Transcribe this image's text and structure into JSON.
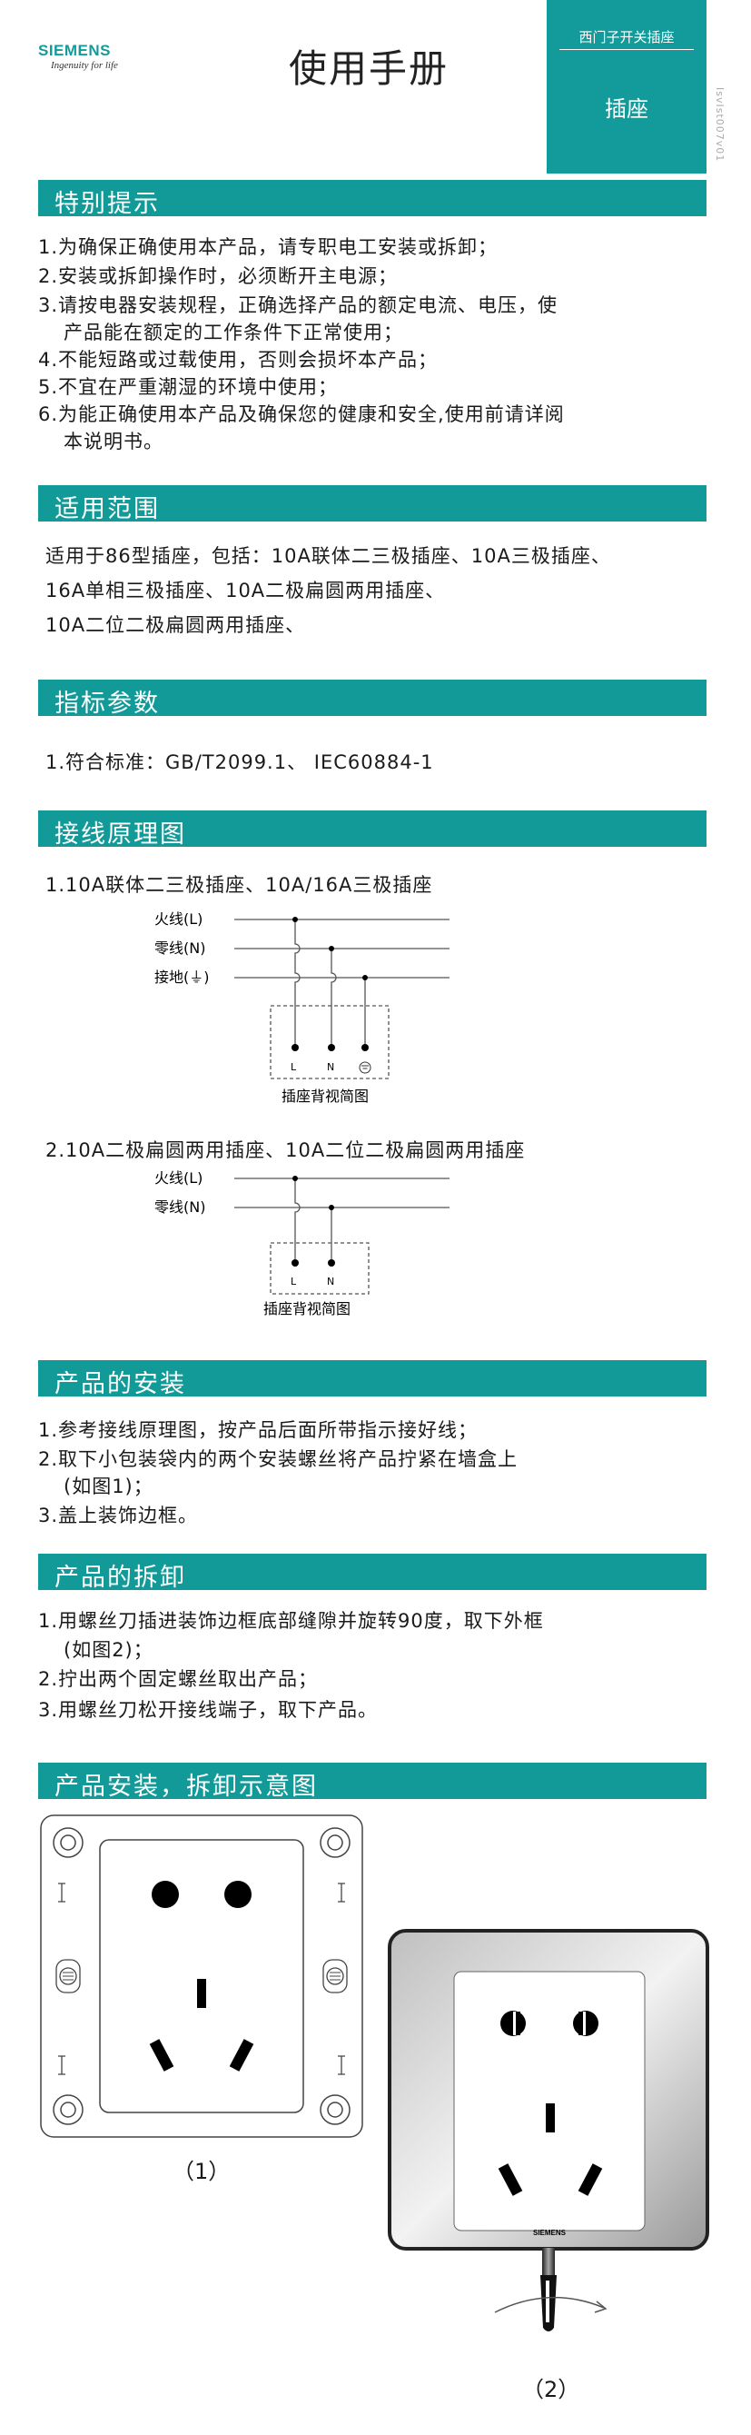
{
  "header": {
    "brand": "SIEMENS",
    "tagline": "Ingenuity for life",
    "title": "使用手册",
    "category": "西门子开关插座",
    "product": "插座",
    "code": "IsvIst007v01"
  },
  "sections": {
    "tips": {
      "heading": "特别提示",
      "items": [
        "1.为确保正确使用本产品，请专职电工安装或拆卸；",
        "2.安装或拆卸操作时，必须断开主电源；",
        "3.请按电器安装规程，正确选择产品的额定电流、电压，使",
        "产品能在额定的工作条件下正常使用；",
        "4.不能短路或过载使用，否则会损坏本产品；",
        "5.不宜在严重潮湿的环境中使用；",
        "6.为能正确使用本产品及确保您的健康和安全,使用前请详阅",
        "本说明书。"
      ]
    },
    "scope": {
      "heading": "适用范围",
      "lines": [
        "适用于86型插座，包括：10A联体二三极插座、10A三极插座、",
        "16A单相三极插座、10A二极扁圆两用插座、",
        "10A二位二极扁圆两用插座、"
      ]
    },
    "params": {
      "heading": "指标参数",
      "items": [
        "1.符合标准：GB/T2099.1、 IEC60884-1"
      ]
    },
    "wiring": {
      "heading": "接线原理图",
      "diagram1_title": "1.10A联体二三极插座、10A/16A三极插座",
      "diagram2_title": "2.10A二极扁圆两用插座、10A二位二极扁圆两用插座",
      "live": "火线(L)",
      "neutral": "零线(N)",
      "earth": "接地(⏚)",
      "term_l": "L",
      "term_n": "N",
      "back_view": "插座背视简图"
    },
    "install": {
      "heading": "产品的安装",
      "items": [
        "1.参考接线原理图，按产品后面所带指示接好线；",
        "2.取下小包装袋内的两个安装螺丝将产品拧紧在墙盒上",
        "(如图1)；",
        "3.盖上装饰边框。"
      ]
    },
    "removal": {
      "heading": "产品的拆卸",
      "items": [
        "1.用螺丝刀插进装饰边框底部缝隙并旋转90度，取下外框",
        "(如图2)；",
        "2.拧出两个固定螺丝取出产品；",
        "3.用螺丝刀松开接线端子，取下产品。"
      ]
    },
    "figures": {
      "heading": "产品安装，拆卸示意图",
      "fig1": "（1）",
      "fig2": "（2）",
      "plate_brand": "SIEMENS"
    }
  },
  "colors": {
    "accent": "#129a98"
  }
}
